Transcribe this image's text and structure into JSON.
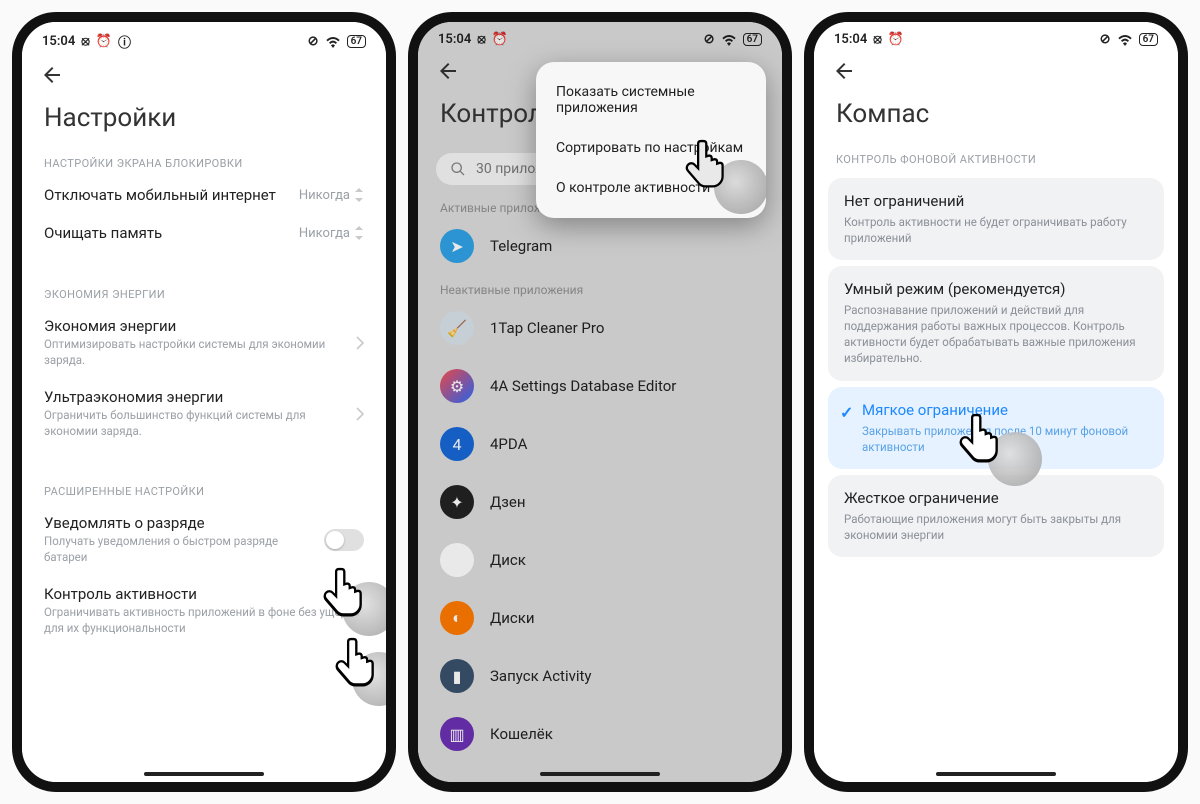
{
  "status": {
    "time": "15:04",
    "battery": "67"
  },
  "phone1": {
    "title": "Настройки",
    "sec_lock": "НАСТРОЙКИ ЭКРАНА БЛОКИРОВКИ",
    "mobile_off": {
      "t": "Отключать мобильный интернет",
      "v": "Никогда"
    },
    "clear_mem": {
      "t": "Очищать память",
      "v": "Никогда"
    },
    "sec_energy": "ЭКОНОМИЯ ЭНЕРГИИ",
    "econ": {
      "t": "Экономия энергии",
      "s": "Оптимизировать настройки системы для экономии заряда."
    },
    "ultra": {
      "t": "Ультраэкономия энергии",
      "s": "Ограничить большинство функций системы для экономии заряда."
    },
    "sec_adv": "РАСШИРЕННЫЕ НАСТРОЙКИ",
    "notify": {
      "t": "Уведомлять о разряде",
      "s": "Получать уведомления о быстром разряде батареи"
    },
    "control": {
      "t": "Контроль активности",
      "s": "Ограничивать активность приложений в фоне без ущерба для их функциональности"
    }
  },
  "phone2": {
    "title": "Контроль",
    "search_placeholder": "30 приложений",
    "sec_active": "Активные приложения",
    "sec_inactive": "Неактивные приложения",
    "active": [
      {
        "name": "Telegram",
        "bg": "#2fa3e6",
        "glyph": "➤"
      }
    ],
    "inactive": [
      {
        "name": "1Tap Cleaner Pro",
        "bg": "#d9e3ea",
        "glyph": "🧹"
      },
      {
        "name": "4A Settings Database Editor",
        "bg": "linear-gradient(135deg,#ff4d4d,#2b6cff)",
        "glyph": "⚙"
      },
      {
        "name": "4PDA",
        "bg": "#1868d6",
        "glyph": "4"
      },
      {
        "name": "Дзен",
        "bg": "#222",
        "glyph": "✦"
      },
      {
        "name": "Диск",
        "bg": "#fff",
        "glyph": "▲"
      },
      {
        "name": "Диски",
        "bg": "#ff7a00",
        "glyph": "◐"
      },
      {
        "name": "Запуск Activity",
        "bg": "#3a506b",
        "glyph": "▮"
      },
      {
        "name": "Кошелёк",
        "bg": "#6b2fb3",
        "glyph": "▥"
      }
    ],
    "popup": {
      "items": [
        "Показать системные приложения",
        "Сортировать по настройкам",
        "О контроле активности"
      ]
    }
  },
  "phone3": {
    "title": "Компас",
    "section": "КОНТРОЛЬ ФОНОВОЙ АКТИВНОСТИ",
    "cards": [
      {
        "t": "Нет ограничений",
        "s": "Контроль активности не будет ограничивать работу приложений"
      },
      {
        "t": "Умный режим (рекомендуется)",
        "s": "Распознавание приложений и действий для поддержания работы важных процессов. Контроль активности будет обрабатывать важные приложения избирательно."
      },
      {
        "t": "Мягкое ограничение",
        "s": "Закрывать приложения после 10 минут фоновой активности",
        "selected": true
      },
      {
        "t": "Жесткое ограничение",
        "s": "Работающие приложения могут быть закрыты для экономии энергии"
      }
    ]
  }
}
